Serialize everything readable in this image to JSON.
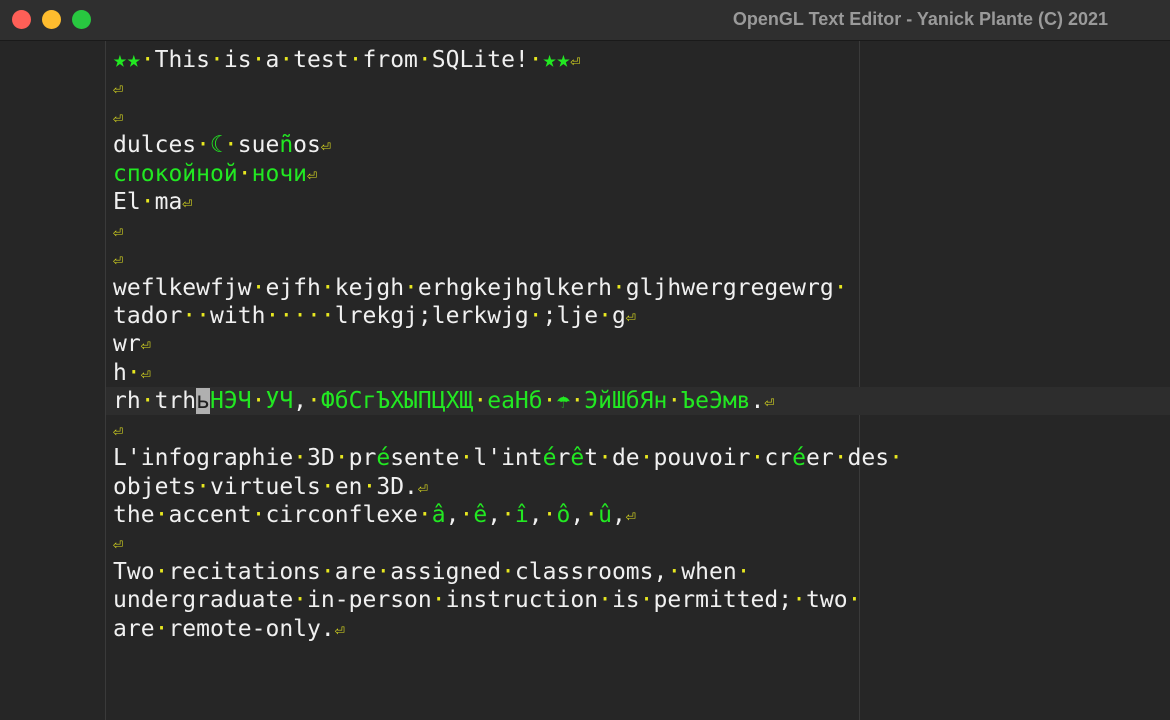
{
  "window": {
    "title": "OpenGL Text Editor - Yanick Plante (C) 2021"
  },
  "editor": {
    "cursor": {
      "line": 12,
      "column": 6
    },
    "colors": {
      "text": "#f0f0f0",
      "unicode": "#22e822",
      "whitespace": "#e8e820"
    },
    "lines": [
      {
        "text": "★★ This is a test from SQLite! ★★",
        "ret": true
      },
      {
        "text": "",
        "ret": true
      },
      {
        "text": "",
        "ret": true
      },
      {
        "text": "dulces ☾ sueños",
        "ret": true
      },
      {
        "text": "спокойной ночи",
        "ret": true
      },
      {
        "text": "El ma",
        "ret": true
      },
      {
        "text": "",
        "ret": true
      },
      {
        "text": "",
        "ret": true
      },
      {
        "text": "weflkewfjw ejfh kejgh erhgkejhglkerh gljhwergregewrg ",
        "ret": false
      },
      {
        "text": "tador  with     lrekgj;lerkwjg ;lje g",
        "ret": true
      },
      {
        "text": "wr",
        "ret": true
      },
      {
        "text": "h ",
        "ret": true
      },
      {
        "text": "rh trhьНЭЧ УЧ, ФбСгЪХЫПЦХЩ еаНб ☂ ЭйШбЯн ЪеЭмв.",
        "ret": true
      },
      {
        "text": "",
        "ret": true
      },
      {
        "text": "L'infographie 3D présente l'intérêt de pouvoir créer des ",
        "ret": false
      },
      {
        "text": "objets virtuels en 3D.",
        "ret": true
      },
      {
        "text": "the accent circonflexe â, ê, î, ô, û,",
        "ret": true
      },
      {
        "text": "",
        "ret": true
      },
      {
        "text": "Two recitations are assigned classrooms, when ",
        "ret": false
      },
      {
        "text": "undergraduate in-person instruction is permitted; two ",
        "ret": false
      },
      {
        "text": "are remote-only.",
        "ret": true
      }
    ]
  }
}
